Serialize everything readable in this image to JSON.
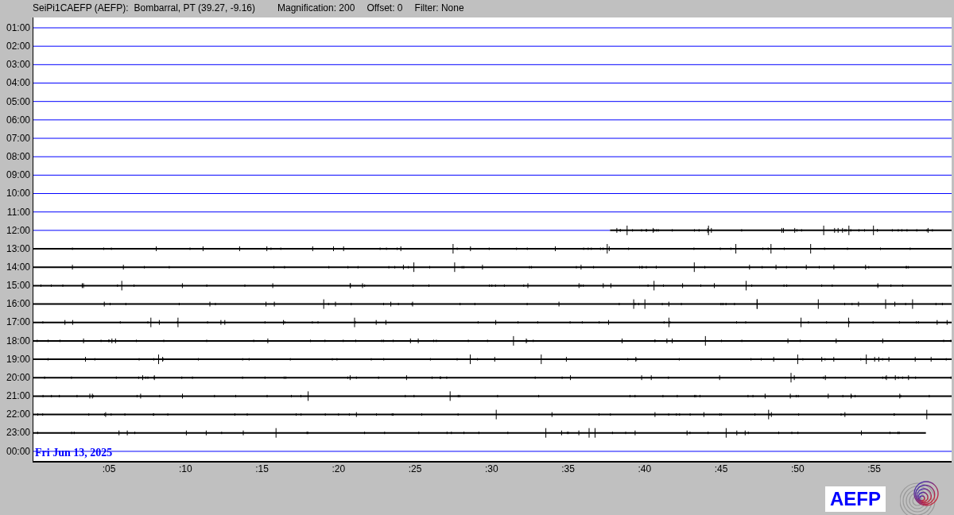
{
  "header": {
    "station": "SeiPi1CAEFP (AEFP):",
    "location": "Bombarral, PT (39.27, -9.16)",
    "magnification": "Magnification: 200",
    "offset": "Offset: 0",
    "filter": "Filter: None"
  },
  "rows": [
    {
      "label": "01:00",
      "kind": "empty"
    },
    {
      "label": "02:00",
      "kind": "empty"
    },
    {
      "label": "03:00",
      "kind": "empty"
    },
    {
      "label": "04:00",
      "kind": "empty"
    },
    {
      "label": "05:00",
      "kind": "empty"
    },
    {
      "label": "06:00",
      "kind": "empty"
    },
    {
      "label": "07:00",
      "kind": "empty"
    },
    {
      "label": "08:00",
      "kind": "empty"
    },
    {
      "label": "09:00",
      "kind": "empty"
    },
    {
      "label": "10:00",
      "kind": "empty"
    },
    {
      "label": "11:00",
      "kind": "empty"
    },
    {
      "label": "12:00",
      "kind": "late-start"
    },
    {
      "label": "13:00",
      "kind": "data"
    },
    {
      "label": "14:00",
      "kind": "data"
    },
    {
      "label": "15:00",
      "kind": "data"
    },
    {
      "label": "16:00",
      "kind": "data"
    },
    {
      "label": "17:00",
      "kind": "data"
    },
    {
      "label": "18:00",
      "kind": "data"
    },
    {
      "label": "19:00",
      "kind": "data"
    },
    {
      "label": "20:00",
      "kind": "data"
    },
    {
      "label": "21:00",
      "kind": "data"
    },
    {
      "label": "22:00",
      "kind": "data"
    },
    {
      "label": "23:00",
      "kind": "early-end"
    },
    {
      "label": "00:00",
      "kind": "empty"
    }
  ],
  "date_label": "Fri Jun 13, 2025",
  "x_ticks": [
    ":05",
    ":10",
    ":15",
    ":20",
    ":25",
    ":30",
    ":35",
    ":40",
    ":45",
    ":50",
    ":55"
  ],
  "logo_text": "AEFP"
}
